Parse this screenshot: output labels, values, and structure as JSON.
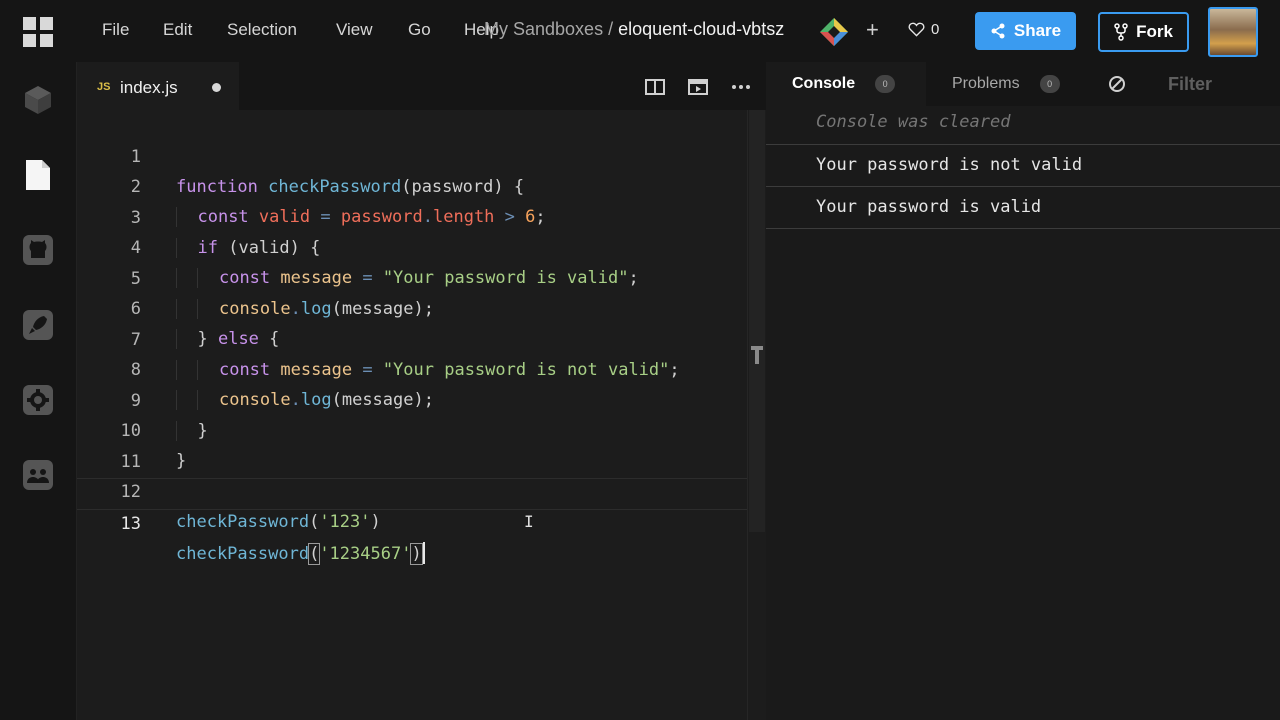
{
  "menu": [
    "File",
    "Edit",
    "Selection",
    "View",
    "Go",
    "Help"
  ],
  "breadcrumb": {
    "parent": "My Sandboxes",
    "separator": "/",
    "name": "eloquent-cloud-vbtsz"
  },
  "likes": {
    "count": "0"
  },
  "actions": {
    "share": "Share",
    "fork": "Fork"
  },
  "sidebar": [
    "sandbox-info-icon",
    "files-icon",
    "github-icon",
    "deploy-icon",
    "settings-icon",
    "live-icon"
  ],
  "tab": {
    "badge": "JS",
    "filename": "index.js"
  },
  "code": {
    "lines": [
      "1",
      "2",
      "3",
      "4",
      "5",
      "6",
      "7",
      "8",
      "9",
      "10",
      "11",
      "12",
      "13"
    ],
    "t": {
      "function": "function",
      "checkPassword": "checkPassword",
      "password": "password",
      "const": "const",
      "valid": "valid",
      "eq": "=",
      "length": "length",
      "gt": ">",
      "six": "6",
      "if": "if",
      "else": "else",
      "message": "message",
      "str_valid": "\"Your password is valid\"",
      "str_invalid": "\"Your password is not valid\"",
      "console": "console",
      "log": "log",
      "arg1": "'123'",
      "arg2": "'1234567'"
    }
  },
  "console": {
    "tabs": {
      "console": "Console",
      "console_count": "0",
      "problems": "Problems",
      "problems_count": "0",
      "filter": "Filter"
    },
    "cleared": "Console was cleared",
    "logs": [
      "Your password is not valid",
      "Your password is valid"
    ]
  },
  "colors": {
    "accent": "#3a9bf0",
    "background": "#151515",
    "editor": "#1c1c1c"
  }
}
